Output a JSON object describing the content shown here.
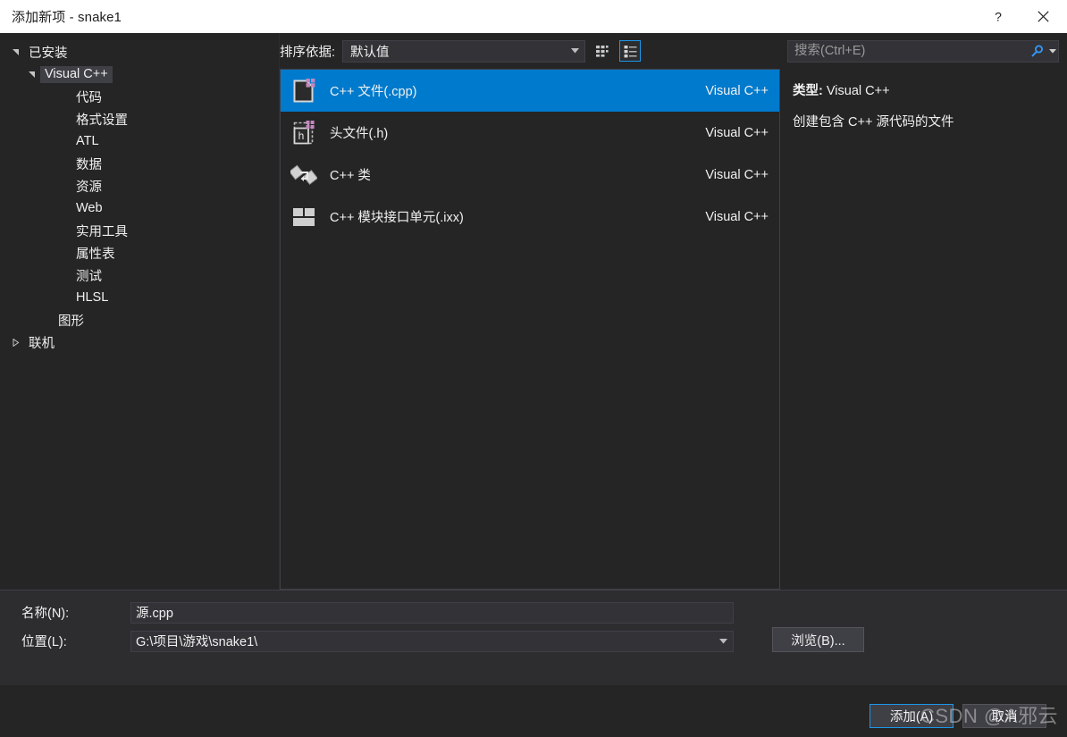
{
  "window": {
    "title": "添加新项 - snake1",
    "help_icon": "question-mark-icon",
    "close_icon": "close-icon",
    "help_label": "?",
    "close_label": "✕"
  },
  "sidebar": {
    "nodes": [
      {
        "label": "已安装",
        "level": 0,
        "state": "expanded",
        "selected": false
      },
      {
        "label": "Visual C++",
        "level": 1,
        "state": "expanded",
        "selected": true
      },
      {
        "label": "代码",
        "level": 2,
        "state": "leaf",
        "selected": false
      },
      {
        "label": "格式设置",
        "level": 2,
        "state": "leaf",
        "selected": false
      },
      {
        "label": "ATL",
        "level": 2,
        "state": "leaf",
        "selected": false
      },
      {
        "label": "数据",
        "level": 2,
        "state": "leaf",
        "selected": false
      },
      {
        "label": "资源",
        "level": 2,
        "state": "leaf",
        "selected": false
      },
      {
        "label": "Web",
        "level": 2,
        "state": "leaf",
        "selected": false
      },
      {
        "label": "实用工具",
        "level": 2,
        "state": "leaf",
        "selected": false
      },
      {
        "label": "属性表",
        "level": 2,
        "state": "leaf",
        "selected": false
      },
      {
        "label": "测试",
        "level": 2,
        "state": "leaf",
        "selected": false
      },
      {
        "label": "HLSL",
        "level": 2,
        "state": "leaf",
        "selected": false
      },
      {
        "label": "图形",
        "level": 1,
        "state": "leaf",
        "selected": false
      },
      {
        "label": "联机",
        "level": 0,
        "state": "collapsed",
        "selected": false
      }
    ]
  },
  "toolbar": {
    "sort_label": "排序依据:",
    "sort_value": "默认值",
    "grid_view_icon": "grid-view-icon",
    "list_view_icon": "list-view-icon",
    "active_view": "list"
  },
  "search": {
    "placeholder": "搜索(Ctrl+E)",
    "value": "",
    "icon": "search-icon",
    "dropdown_icon": "chevron-down-icon",
    "accent": "#3399ff"
  },
  "templates": {
    "items": [
      {
        "name": "C++ 文件(.cpp)",
        "category": "Visual C++",
        "icon": "cpp-file-icon",
        "selected": true
      },
      {
        "name": "头文件(.h)",
        "category": "Visual C++",
        "icon": "header-file-icon",
        "selected": false
      },
      {
        "name": "C++ 类",
        "category": "Visual C++",
        "icon": "cpp-class-icon",
        "selected": false
      },
      {
        "name": "C++ 模块接口单元(.ixx)",
        "category": "Visual C++",
        "icon": "cpp-module-icon",
        "selected": false
      }
    ]
  },
  "info": {
    "type_label": "类型:",
    "type_value": "Visual C++",
    "description": "创建包含 C++ 源代码的文件"
  },
  "form": {
    "name_label": "名称(N):",
    "name_value": "源.cpp",
    "location_label": "位置(L):",
    "location_value": "G:\\项目\\游戏\\snake1\\",
    "browse_label": "浏览(B)..."
  },
  "footer": {
    "add_label": "添加(A)",
    "cancel_label": "取消"
  },
  "watermark": {
    "text": "CSDN @A邪云"
  },
  "colors": {
    "selection": "#007acc",
    "accent_border": "#1c97ea",
    "dialog_bg": "#252526",
    "form_bg": "#2d2d30",
    "titlebar_bg": "#ffffff"
  }
}
